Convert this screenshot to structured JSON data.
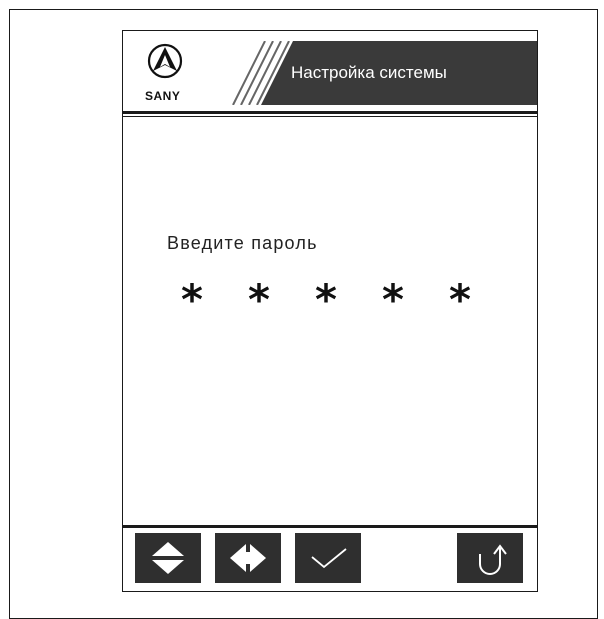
{
  "header": {
    "brand": "SANY",
    "title": "Настройка системы"
  },
  "main": {
    "prompt": "Введите пароль",
    "password_mask": [
      "*",
      "*",
      "*",
      "*",
      "*"
    ]
  },
  "softkeys": [
    {
      "name": "up-down",
      "icon": "up-down-arrow-icon"
    },
    {
      "name": "left-right",
      "icon": "left-right-arrow-icon"
    },
    {
      "name": "confirm",
      "icon": "checkmark-icon"
    },
    {
      "name": "back",
      "icon": "return-arrow-icon"
    }
  ],
  "colors": {
    "softkey_bg": "#2f2f2f",
    "header_bar": "#3a3a3a"
  }
}
